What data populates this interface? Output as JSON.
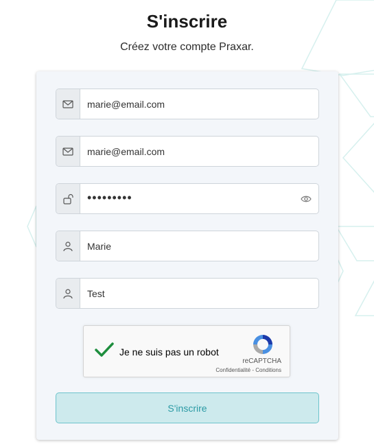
{
  "header": {
    "title": "S'inscrire",
    "subtitle": "Créez votre compte Praxar."
  },
  "form": {
    "email": {
      "value": "marie@email.com",
      "icon": "envelope-icon"
    },
    "email_confirm": {
      "value": "marie@email.com",
      "icon": "envelope-icon"
    },
    "password": {
      "value": "•••••••••",
      "icon": "unlock-icon",
      "toggle_icon": "eye-icon"
    },
    "first_name": {
      "value": "Marie",
      "icon": "user-icon"
    },
    "last_name": {
      "value": "Test",
      "icon": "user-icon"
    }
  },
  "captcha": {
    "label": "Je ne suis pas un robot",
    "brand": "reCAPTCHA",
    "legal": "Confidentialité - Conditions",
    "checked": true
  },
  "submit": {
    "label": "S'inscrire"
  },
  "colors": {
    "accent": "#2a9aa4",
    "button_bg": "#cdeaed",
    "card_bg": "#f3f6fa",
    "check": "#1e8e3e"
  }
}
